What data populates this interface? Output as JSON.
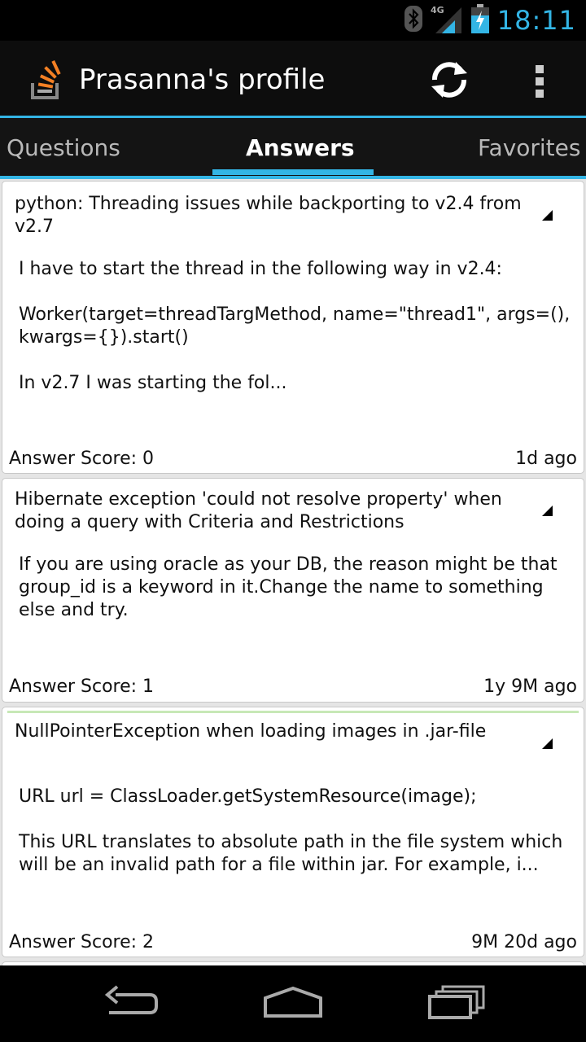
{
  "status_bar": {
    "time": "18:11",
    "network": "4G",
    "icons": [
      "bluetooth-icon",
      "signal-icon",
      "battery-charging-icon"
    ],
    "accent_color": "#33b5e5"
  },
  "action_bar": {
    "title": "Prasanna's profile",
    "icons": [
      "stackoverflow-logo-icon",
      "refresh-icon",
      "overflow-menu-icon"
    ]
  },
  "tabs": [
    {
      "label": "Questions",
      "active": false
    },
    {
      "label": "Answers",
      "active": true
    },
    {
      "label": "Favorites",
      "active": false
    }
  ],
  "answers": [
    {
      "title": "python: Threading issues while backporting to v2.4 from v2.7",
      "body": [
        "I have to start the thread in the following way in v2.4:",
        "Worker(target=threadTargMethod, name=\"thread1\", args=(), kwargs={}).start()",
        "In v2.7 I was starting the fol..."
      ],
      "score": "Answer Score: 0",
      "time": "1d ago",
      "accepted": false
    },
    {
      "title": "Hibernate exception 'could not resolve property' when doing a query with Criteria and Restrictions",
      "body": [
        "If you are using oracle as your DB, the reason might be that group_id is a keyword in it.Change the name to something else and try."
      ],
      "score": "Answer Score: 1",
      "time": "1y 9M ago",
      "accepted": false
    },
    {
      "title": "NullPointerException when loading images in .jar-file",
      "body": [
        "URL url = ClassLoader.getSystemResource(image);",
        "This URL translates to absolute path in the file system which will be an invalid path for a file within jar. For example, i..."
      ],
      "score": "Answer Score: 2",
      "time": "9M 20d ago",
      "accepted": true
    }
  ],
  "nav_bar": {
    "icons": [
      "back-icon",
      "home-icon",
      "recent-apps-icon"
    ]
  }
}
